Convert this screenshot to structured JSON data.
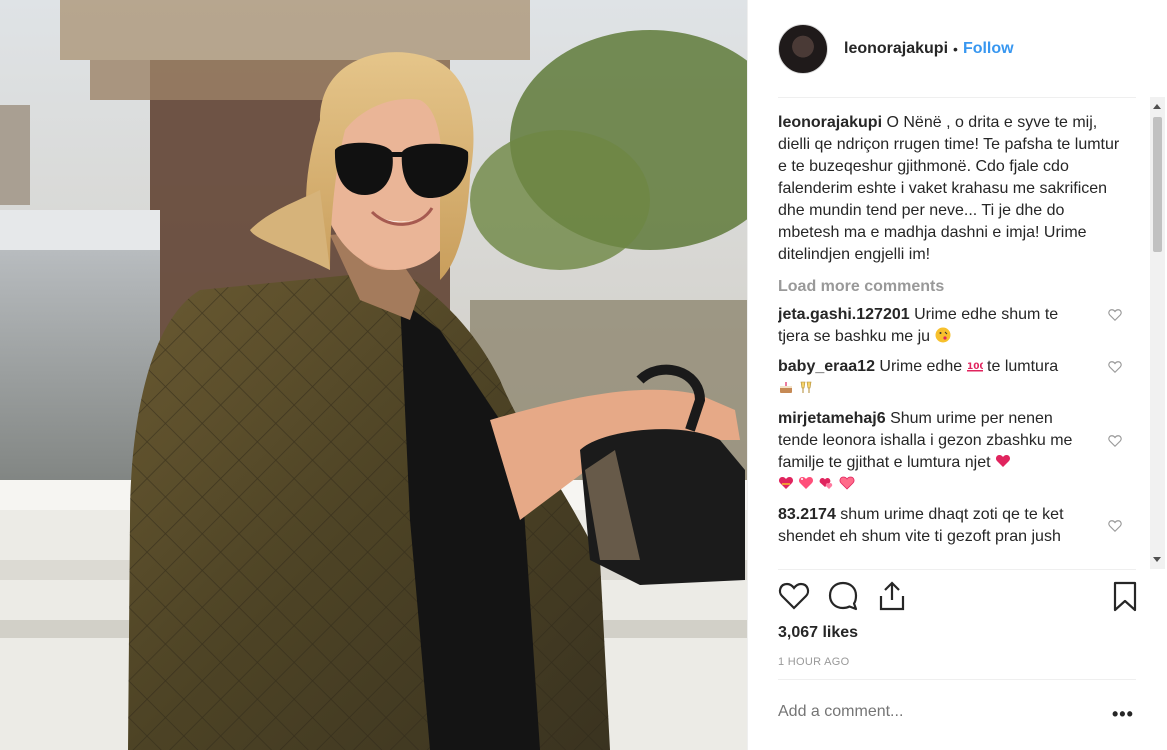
{
  "post": {
    "username": "leonorajakupi",
    "follow_label": "Follow",
    "separator": "•",
    "caption": "O Nënë , o drita e syve te mij, dielli qe ndriçon rrugen time! Te pafsha te lumtur e te buzeqeshur gjithmonë. Cdo fjale cdo falenderim eshte i vaket krahasu me sakrificen dhe mundin tend per neve... Ti je dhe do mbetesh ma e madhja dashni e imja! Urime ditelindjen engjelli im!",
    "load_more": "Load more comments",
    "comments": [
      {
        "user": "jeta.gashi.127201",
        "text": "Urime edhe shum te tjera se bashku me ju",
        "emoji": [
          "kiss-face-emoji"
        ]
      },
      {
        "user": "baby_eraa12",
        "text_a": "Urime edhe",
        "text_b": "te lumtura",
        "emoji": [
          "100-emoji",
          "cake-emoji",
          "clinking-glasses-emoji"
        ]
      },
      {
        "user": "mirjetamehaj6",
        "text": "Shum urime per nenen tende leonora ishalla i gezon zbashku me familje te gjithat e lumtura njet",
        "emoji": [
          "red-heart-emoji",
          "heart-fire-emoji",
          "sparkling-heart-emoji",
          "hearts-exchange-emoji",
          "heart-emoji"
        ]
      },
      {
        "user": "83.2174",
        "text": "shum urime dhaqt zoti qe te ket shendet eh shum vite ti gezoft pran jush"
      }
    ],
    "likes": "3,067 likes",
    "time": "1 HOUR AGO",
    "add_comment_placeholder": "Add a comment...",
    "more_label": "•••"
  },
  "colors": {
    "accent": "#3897f0",
    "muted": "#999999",
    "text": "#262626"
  },
  "icons": [
    "heart-icon",
    "comment-icon",
    "share-icon",
    "bookmark-icon"
  ]
}
